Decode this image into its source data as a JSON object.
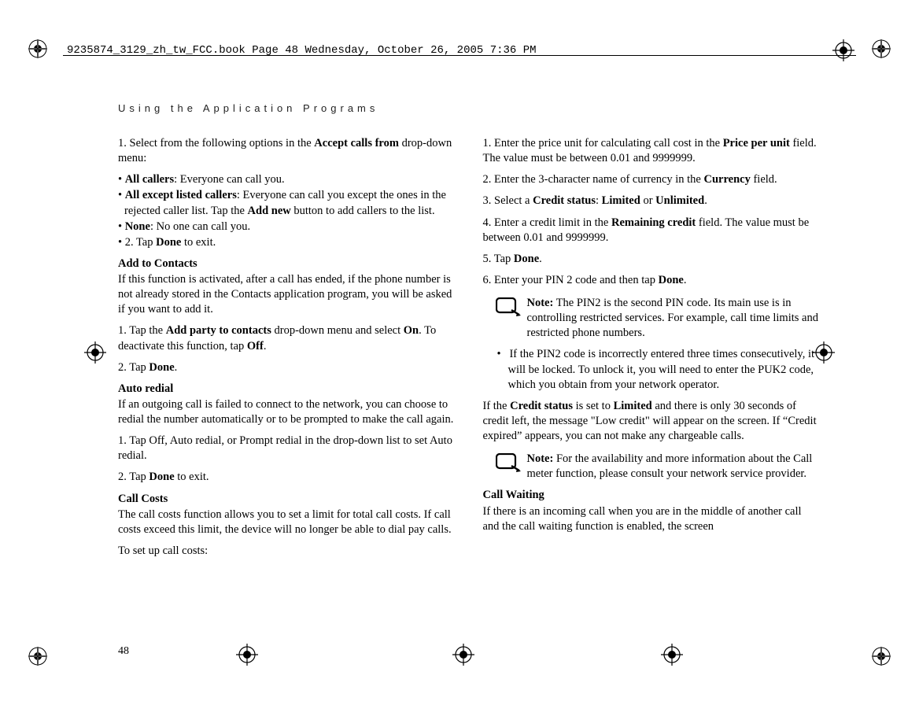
{
  "header": {
    "meta_line": "9235874_3129_zh_tw_FCC.book  Page 48  Wednesday, October 26, 2005  7:36 PM"
  },
  "section_title": "Using the Application Programs",
  "page_number": "48",
  "left": {
    "step1_prefix": "1. Select from the following options in the ",
    "step1_bold": "Accept calls from",
    "step1_suffix": " drop-down menu:",
    "bullet1_bold": "All callers",
    "bullet1_text": ": Everyone can call you.",
    "bullet2_bold": "All except listed callers",
    "bullet2_text": ": Everyone can call you except the ones in the rejected caller list. Tap the ",
    "bullet2_bold2": "Add new",
    "bullet2_suffix": " button to add callers to the list.",
    "bullet3_bold": "None",
    "bullet3_text": ": No one can call you.",
    "step2_prefix": "• 2. Tap ",
    "step2_bold": "Done",
    "step2_suffix": " to exit.",
    "addcontacts_head": "Add to Contacts",
    "addcontacts_body": "If this function is activated, after a call has ended, if the phone number is not already stored in the Contacts application program, you will be asked if you want to add it.",
    "addcontacts_s1_a": "1. Tap the ",
    "addcontacts_s1_b": "Add party to contacts",
    "addcontacts_s1_c": " drop-down menu and select ",
    "addcontacts_s1_d": "On",
    "addcontacts_s1_e": ".  To deactivate this function, tap ",
    "addcontacts_s1_f": "Off",
    "addcontacts_s1_g": ".",
    "addcontacts_s2_a": "2. Tap ",
    "addcontacts_s2_b": "Done",
    "addcontacts_s2_c": ".",
    "autoredial_head": "Auto redial",
    "autoredial_body": "If an outgoing call is failed to connect to the network, you can choose to redial the number automatically or to be prompted to make the call again.",
    "autoredial_s1": "1. Tap Off, Auto redial, or Prompt redial in the drop-down list to set Auto redial.",
    "autoredial_s2_a": "2. Tap ",
    "autoredial_s2_b": "Done",
    "autoredial_s2_c": " to exit.",
    "callcosts_head": "Call Costs",
    "callcosts_body": "The call costs function allows you to set a limit for total call costs. If call costs exceed this limit, the device will no longer be able to dial pay calls.",
    "callcosts_setup": "To set up call costs:"
  },
  "right": {
    "s1_a": "1. Enter the price unit for calculating call cost in the ",
    "s1_b": "Price per unit",
    "s1_c": " field. The value must be between 0.01 and 9999999.",
    "s2_a": "2. Enter the 3-character name of currency in the ",
    "s2_b": "Currency",
    "s2_c": " field.",
    "s3_a": "3. Select a ",
    "s3_b": "Credit status",
    "s3_c": ": ",
    "s3_d": "Limited",
    "s3_e": " or ",
    "s3_f": "Unlimited",
    "s3_g": ".",
    "s4_a": "4. Enter a credit limit in the ",
    "s4_b": "Remaining credit",
    "s4_c": " field. The value must be between 0.01 and 9999999.",
    "s5_a": "5. Tap ",
    "s5_b": "Done",
    "s5_c": ".",
    "s6_a": "6. Enter your PIN 2 code and then tap ",
    "s6_b": "Done",
    "s6_c": ".",
    "note1_label": "Note:",
    "note1_text": " The PIN2 is the second PIN code. Its main use is in controlling restricted services. For example, call time limits and restricted phone numbers.",
    "note1_sub_a": "•",
    "note1_sub_b": "If the PIN2 code is incorrectly entered three times consecutively, it will be locked. To unlock it, you will need to enter the PUK2 code, which you obtain from your network operator.",
    "credit_para_a": "If the ",
    "credit_para_b": "Credit status",
    "credit_para_c": " is set to ",
    "credit_para_d": "Limited",
    "credit_para_e": " and there is only 30 seconds of credit left, the message \"Low credit\" will appear on the screen. If “Credit expired” appears, you can not make any chargeable calls.",
    "note2_label": "Note:",
    "note2_text": " For the availability and more information about the Call meter function, please consult your network service provider.",
    "callwaiting_head": "Call Waiting",
    "callwaiting_body": "If there is an incoming call when you are in the middle of another call and the call waiting function is enabled, the screen"
  }
}
